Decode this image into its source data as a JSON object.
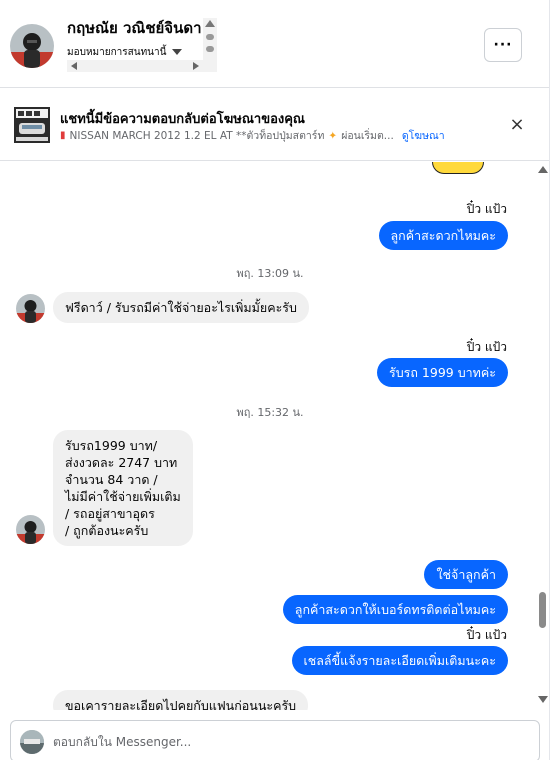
{
  "header": {
    "contact_name": "กฤษณัย วณิชย์จินดา",
    "assign_label": "มอบหมายการสนทนานี้",
    "more_label": "···"
  },
  "ad_banner": {
    "title": "แชทนี้มีข้อความตอบกลับต่อโฆษณาของคุณ",
    "ad_text": "NISSAN MARCH 2012 1.2 EL AT **ตัวท็อปปุ่มสตาร์ท",
    "ad_text_suffix": "ผ่อนเริ่มต...",
    "view_ad_link": "ดูโฆษณา",
    "close_label": "×"
  },
  "messages": [
    {
      "sender": "ปิ๋ว แป้ว",
      "text": "ลูกค้าสะดวกไหมคะ"
    },
    {
      "time": "พฤ. 13:09 น."
    },
    {
      "text": "ฟรีดาว์ / รับรถมีค่าใช้จ่ายอะไรเพิ่มมั้ยคะรับ"
    },
    {
      "sender": "ปิ๋ว แป้ว",
      "text": "รับรถ 1999 บาทค่ะ"
    },
    {
      "time": "พฤ. 15:32 น."
    },
    {
      "lines": [
        "รับรถ1999 บาท/",
        "ส่งงวดละ 2747 บาท",
        "จำนวน 84 วาด /",
        "ไม่มีค่าใช้จ่ายเพิ่มเติม",
        "/ รถอยู่สาขาอุดร",
        "/ ถูกต้องนะครับ"
      ]
    },
    {
      "text": "ใช่จ้าลูกค้า"
    },
    {
      "text": "ลูกค้าสะดวกให้เบอร์ดทรติดต่อไหมคะ"
    },
    {
      "sender": "ปิ๋ว แป้ว",
      "text": "เชลล์ขี้แจ้งรายละเอียดเพิ่มเติมนะคะ"
    },
    {
      "text": "ขอเคารายละเอียดไปคุยกับแฟนก่อนนะครับ"
    }
  ],
  "composer": {
    "placeholder": "ตอบกลับใน Messenger..."
  },
  "colors": {
    "outgoing_bubble": "#0866ff",
    "incoming_bubble": "#f0f0f0",
    "link": "#0866ff"
  }
}
